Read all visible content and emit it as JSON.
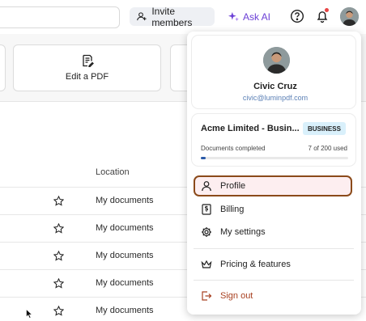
{
  "topbar": {
    "invite_label": "Invite members",
    "ask_ai_label": "Ask AI"
  },
  "actions": {
    "edit_pdf_label": "Edit a PDF"
  },
  "table": {
    "location_header": "Location",
    "rows": [
      {
        "location": "My documents"
      },
      {
        "location": "My documents"
      },
      {
        "location": "My documents"
      },
      {
        "location": "My documents"
      },
      {
        "location": "My documents"
      }
    ]
  },
  "menu": {
    "user_name": "Civic Cruz",
    "user_email": "civic@luminpdf.com",
    "plan_name": "Acme Limited - Busin...",
    "plan_badge": "BUSINESS",
    "docs_label": "Documents completed",
    "docs_count": "7 of 200 used",
    "docs_progress_fraction": 0.035,
    "items": {
      "profile": "Profile",
      "billing": "Billing",
      "settings": "My settings",
      "pricing": "Pricing & features",
      "signout": "Sign out"
    }
  },
  "colors": {
    "ask_ai": "#6b3fd6",
    "badge_bg": "#d9f0fb",
    "active_border": "#8b4a1a",
    "signout": "#a84020",
    "email": "#5a7fb5",
    "notification_dot": "#e84545"
  }
}
